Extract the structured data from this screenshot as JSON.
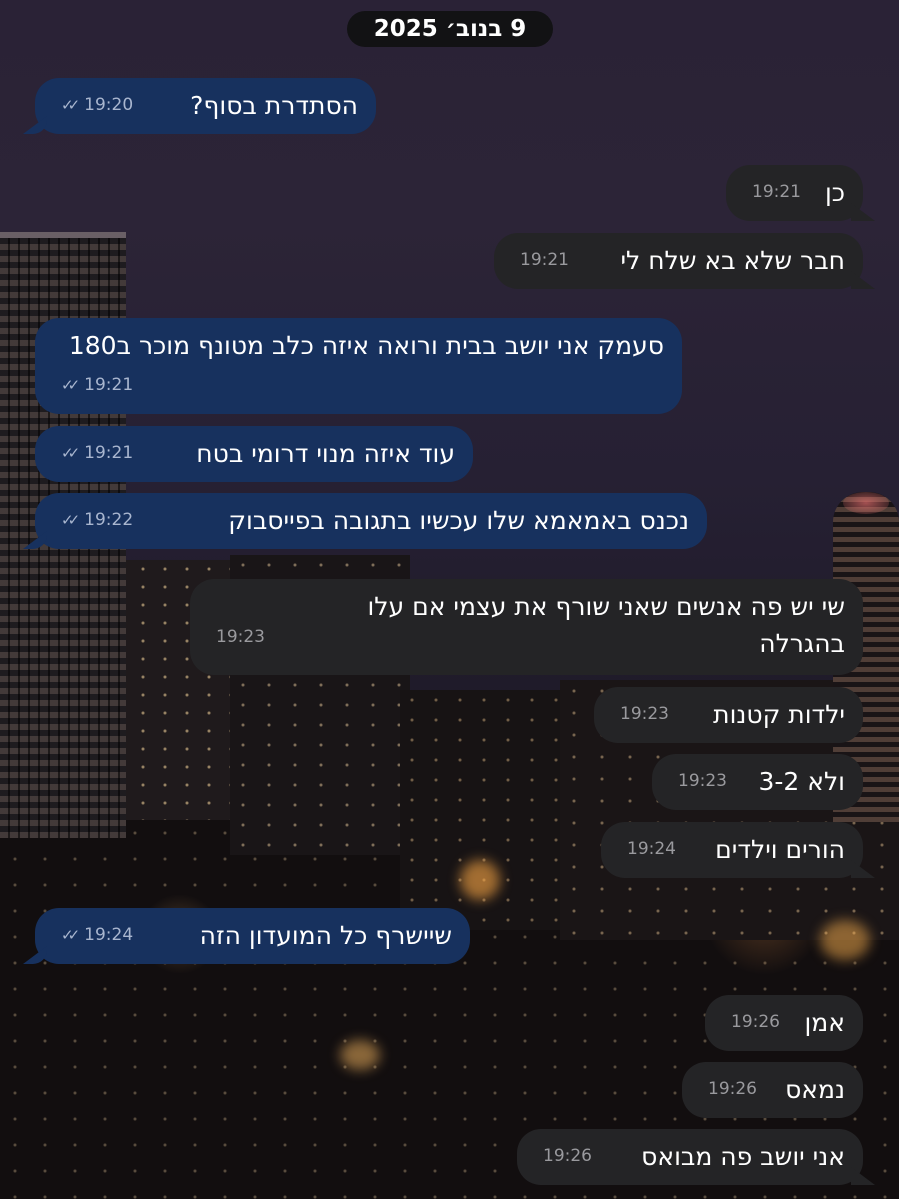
{
  "date_separator": "9 בנוב׳ 2025",
  "messages": [
    {
      "dir": "out",
      "text": "הסתדרת בסוף?",
      "time": "19:20",
      "read": true
    },
    {
      "dir": "in",
      "text": "כן",
      "time": "19:21"
    },
    {
      "dir": "in",
      "text": "חבר שלא בא שלח לי",
      "time": "19:21"
    },
    {
      "dir": "out",
      "text": "סעמק אני יושב בבית ורואה איזה כלב מטונף מוכר ב180",
      "time": "19:21",
      "read": true
    },
    {
      "dir": "out",
      "text": "עוד איזה מנוי דרומי בטח",
      "time": "19:21",
      "read": true
    },
    {
      "dir": "out",
      "text": "נכנס באמאמא שלו עכשיו בתגובה בפייסבוק",
      "time": "19:22",
      "read": true
    },
    {
      "dir": "in",
      "text": "שי יש פה אנשים שאני שורף את עצמי אם עלו בהגרלה",
      "time": "19:23"
    },
    {
      "dir": "in",
      "text": "ילדות קטנות",
      "time": "19:23"
    },
    {
      "dir": "in",
      "text": "ולא 3-2",
      "time": "19:23"
    },
    {
      "dir": "in",
      "text": "הורים וילדים",
      "time": "19:24"
    },
    {
      "dir": "out",
      "text": "שיישרף כל המועדון הזה",
      "time": "19:24",
      "read": true
    },
    {
      "dir": "in",
      "text": "אמן",
      "time": "19:26"
    },
    {
      "dir": "in",
      "text": "נמאס",
      "time": "19:26"
    },
    {
      "dir": "in",
      "text": "אני יושב פה מבואס",
      "time": "19:26"
    }
  ],
  "colors": {
    "outgoing": "#17315e",
    "incoming": "#242426",
    "date_pill": "#121214"
  },
  "icons": {
    "read_receipt": "double-check-icon"
  }
}
